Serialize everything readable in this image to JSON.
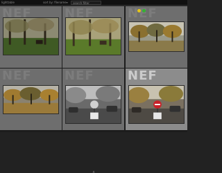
{
  "toolbar": {
    "title": "lighttable",
    "sort_label": "sort by: filename",
    "filter_label": "≡",
    "search_text": "search filter",
    "menu_icon": "settings-icon"
  },
  "thumbnails": [
    {
      "id": "t1",
      "ext": "NEF",
      "selected": false,
      "grayscale": false,
      "scene": "bench-park"
    },
    {
      "id": "t2",
      "ext": "NEF",
      "selected": false,
      "grayscale": false,
      "scene": "bench-park-bright"
    },
    {
      "id": "t3",
      "ext": "NEF",
      "selected": false,
      "grayscale": false,
      "scene": "park-trees",
      "color_labels": [
        "#e6c619",
        "#34b233"
      ]
    },
    {
      "id": "t4",
      "ext": "NEF",
      "selected": false,
      "grayscale": false,
      "scene": "park-trees-wide"
    },
    {
      "id": "t5",
      "ext": "NEF",
      "selected": false,
      "grayscale": true,
      "scene": "street-sign"
    },
    {
      "id": "t6",
      "ext": "NEF",
      "selected": true,
      "grayscale": false,
      "scene": "street-sign"
    }
  ],
  "colors": {
    "background": "#222222",
    "cell": "#6e6e6e",
    "cell_selected": "#8c8c8c",
    "label_yellow": "#e6c619",
    "label_green": "#34b233"
  },
  "bottom_handle_icon": "drag-handle-icon"
}
